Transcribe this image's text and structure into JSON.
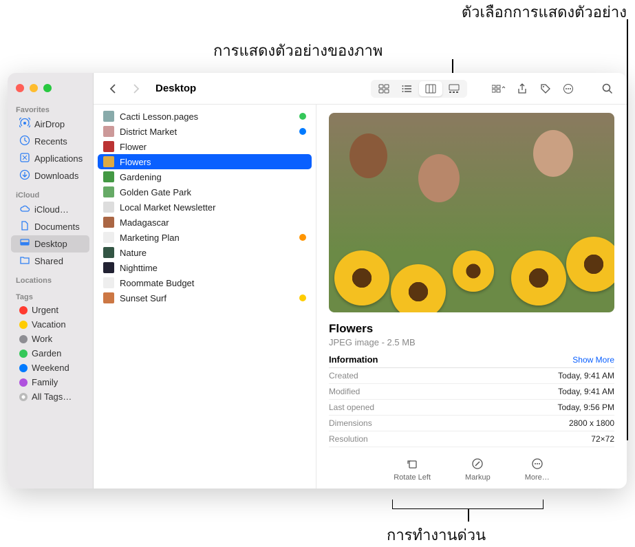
{
  "callouts": {
    "preview_options": "ตัวเลือกการแสดงตัวอย่าง",
    "image_preview": "การแสดงตัวอย่างของภาพ",
    "quick_actions": "การทำงานด่วน"
  },
  "window_title": "Desktop",
  "sidebar": {
    "favorites_head": "Favorites",
    "favorites": [
      {
        "icon": "airdrop",
        "label": "AirDrop"
      },
      {
        "icon": "clock",
        "label": "Recents"
      },
      {
        "icon": "apps",
        "label": "Applications"
      },
      {
        "icon": "download",
        "label": "Downloads"
      }
    ],
    "icloud_head": "iCloud",
    "icloud": [
      {
        "icon": "cloud",
        "label": "iCloud…"
      },
      {
        "icon": "doc",
        "label": "Documents"
      },
      {
        "icon": "desktop",
        "label": "Desktop",
        "selected": true
      },
      {
        "icon": "folder",
        "label": "Shared"
      }
    ],
    "locations_head": "Locations",
    "tags_head": "Tags",
    "tags": [
      {
        "color": "#ff3b30",
        "label": "Urgent"
      },
      {
        "color": "#ffcc00",
        "label": "Vacation"
      },
      {
        "color": "#8e8e93",
        "label": "Work"
      },
      {
        "color": "#34c759",
        "label": "Garden"
      },
      {
        "color": "#007aff",
        "label": "Weekend"
      },
      {
        "color": "#af52de",
        "label": "Family"
      }
    ],
    "all_tags": "All Tags…"
  },
  "files": [
    {
      "name": "Cacti Lesson.pages",
      "icon": "#8aa",
      "dot": "#34c759"
    },
    {
      "name": "District Market",
      "icon": "#c99",
      "dot": "#007aff"
    },
    {
      "name": "Flower",
      "icon": "#b33"
    },
    {
      "name": "Flowers",
      "icon": "#da4",
      "selected": true
    },
    {
      "name": "Gardening",
      "icon": "#494"
    },
    {
      "name": "Golden Gate Park",
      "icon": "#6a6"
    },
    {
      "name": "Local Market Newsletter",
      "icon": "#ddd"
    },
    {
      "name": "Madagascar",
      "icon": "#a64"
    },
    {
      "name": "Marketing Plan",
      "icon": "#eee",
      "dot": "#ff9500"
    },
    {
      "name": "Nature",
      "icon": "#354"
    },
    {
      "name": "Nighttime",
      "icon": "#223"
    },
    {
      "name": "Roommate Budget",
      "icon": "#eee"
    },
    {
      "name": "Sunset Surf",
      "icon": "#c74",
      "dot": "#ffcc00"
    }
  ],
  "preview": {
    "title": "Flowers",
    "subtitle": "JPEG image - 2.5 MB",
    "info_header": "Information",
    "show_more": "Show More",
    "rows": [
      {
        "k": "Created",
        "v": "Today, 9:41 AM"
      },
      {
        "k": "Modified",
        "v": "Today, 9:41 AM"
      },
      {
        "k": "Last opened",
        "v": "Today, 9:56 PM"
      },
      {
        "k": "Dimensions",
        "v": "2800 x 1800"
      },
      {
        "k": "Resolution",
        "v": "72×72"
      }
    ],
    "actions": [
      {
        "icon": "rotate",
        "label": "Rotate Left"
      },
      {
        "icon": "markup",
        "label": "Markup"
      },
      {
        "icon": "more",
        "label": "More…"
      }
    ]
  }
}
